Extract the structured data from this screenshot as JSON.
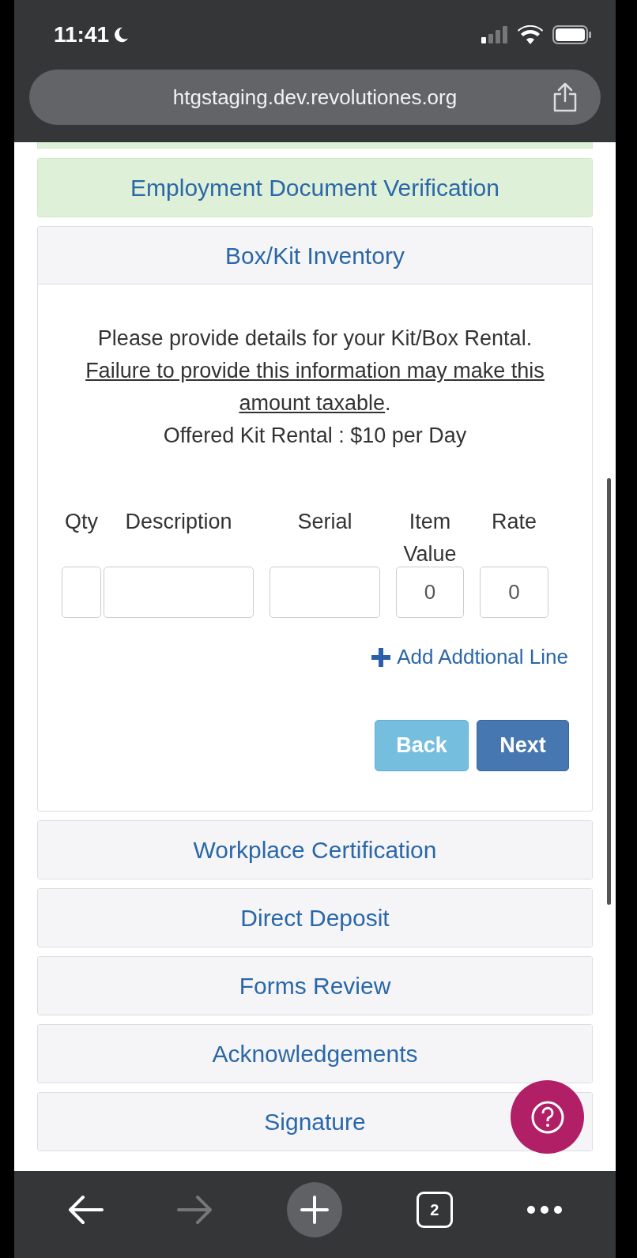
{
  "status_bar": {
    "time": "11:41"
  },
  "browser": {
    "url": "htgstaging.dev.revolutiones.org",
    "tab_count": "2",
    "forward_disabled": true
  },
  "sections": [
    {
      "title": "Employment Document Verification",
      "completed": true,
      "expanded": false
    },
    {
      "title": "Box/Kit Inventory",
      "completed": false,
      "expanded": true
    },
    {
      "title": "Workplace Certification",
      "completed": false,
      "expanded": false
    },
    {
      "title": "Direct Deposit",
      "completed": false,
      "expanded": false
    },
    {
      "title": "Forms Review",
      "completed": false,
      "expanded": false
    },
    {
      "title": "Acknowledgements",
      "completed": false,
      "expanded": false
    },
    {
      "title": "Signature",
      "completed": false,
      "expanded": false
    }
  ],
  "kit_form": {
    "intro": "Please provide details for your Kit/Box Rental.",
    "warning": "Failure to provide this information may make this amount taxable",
    "warning_end": ".",
    "offer": "Offered Kit Rental : $10 per Day",
    "columns": [
      {
        "label": "Qty"
      },
      {
        "label": "Description"
      },
      {
        "label": "Serial"
      },
      {
        "label": "Item Value",
        "value": "0"
      },
      {
        "label": "Rate",
        "value": "0"
      }
    ],
    "add_line": "Add Addtional Line",
    "back": "Back",
    "next": "Next"
  }
}
